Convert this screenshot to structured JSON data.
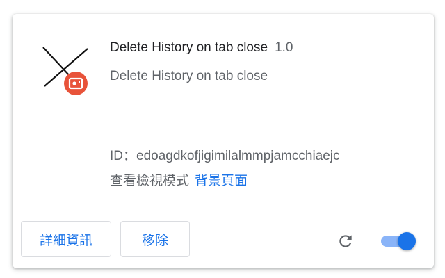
{
  "extension": {
    "name": "Delete History on tab close",
    "version": "1.0",
    "description": "Delete History on tab close",
    "id_label": "ID：",
    "id_value": "edoagdkofjigimilalmmpjamcchiaejc",
    "inspect_label": "查看檢視模式",
    "inspect_link": "背景頁面",
    "icon": "x-mark-icon",
    "badge_icon": "recorder-badge-icon",
    "enabled": true
  },
  "buttons": {
    "details": "詳細資訊",
    "remove": "移除"
  },
  "controls": {
    "reload_icon": "reload-icon",
    "toggle_state": "on"
  },
  "colors": {
    "accent": "#1a73e8",
    "toggle_track": "#8ab4f8",
    "badge": "#e8533a",
    "text_primary": "#202124",
    "text_secondary": "#5f6368"
  }
}
